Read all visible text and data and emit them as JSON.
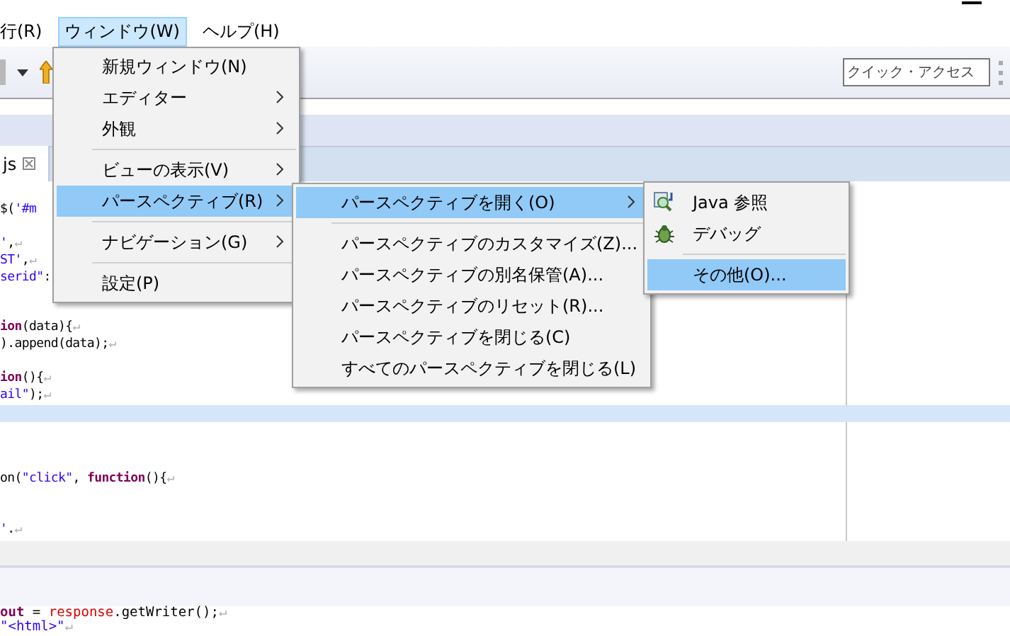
{
  "menu_bar": [
    {
      "label": "行(R)",
      "selected": false
    },
    {
      "label": "ウィンドウ(W)",
      "selected": true
    },
    {
      "label": "ヘルプ(H)",
      "selected": false
    }
  ],
  "toolbar": {
    "quick_access": {
      "placeholder": "クイック・アクセス"
    }
  },
  "editor_tab": {
    "label": "js"
  },
  "editor": {
    "lines": [
      {
        "current": false,
        "segments": [
          {
            "text": "$(",
            "kind": "plain"
          },
          {
            "text": "'#m",
            "kind": "string"
          }
        ]
      },
      {
        "current": false
      },
      {
        "current": false,
        "segments": [
          {
            "text": "'",
            "kind": "string"
          },
          {
            "text": ",",
            "kind": "plain"
          },
          {
            "text": "↵",
            "kind": "mark"
          }
        ]
      },
      {
        "current": false,
        "segments": [
          {
            "text": "ST'",
            "kind": "string"
          },
          {
            "text": ",",
            "kind": "plain"
          },
          {
            "text": "↵",
            "kind": "mark"
          }
        ]
      },
      {
        "current": false,
        "segments": [
          {
            "text": "serid\"",
            "kind": "string"
          },
          {
            "text": ":",
            "kind": "plain"
          }
        ]
      },
      {
        "current": false
      },
      {
        "current": false
      },
      {
        "current": false,
        "segments": [
          {
            "text": "ion",
            "kind": "keyword"
          },
          {
            "text": "(data){",
            "kind": "plain"
          },
          {
            "text": "↵",
            "kind": "mark"
          }
        ]
      },
      {
        "current": false,
        "segments": [
          {
            "text": ").append(data);",
            "kind": "plain"
          },
          {
            "text": "↵",
            "kind": "mark"
          }
        ]
      },
      {
        "current": false
      },
      {
        "current": false,
        "segments": [
          {
            "text": "ion",
            "kind": "keyword"
          },
          {
            "text": "(){",
            "kind": "plain"
          },
          {
            "text": "↵",
            "kind": "mark"
          }
        ]
      },
      {
        "current": false,
        "segments": [
          {
            "text": "ail\"",
            "kind": "string"
          },
          {
            "text": ");",
            "kind": "plain"
          },
          {
            "text": "↵",
            "kind": "mark"
          }
        ]
      },
      {
        "current": true
      },
      {
        "current": false
      },
      {
        "current": false
      },
      {
        "current": false
      },
      {
        "current": false,
        "segments": [
          {
            "text": "on(",
            "kind": "plain"
          },
          {
            "text": "\"click\"",
            "kind": "string"
          },
          {
            "text": ", ",
            "kind": "plain"
          },
          {
            "text": "function",
            "kind": "keyword"
          },
          {
            "text": "(){",
            "kind": "plain"
          },
          {
            "text": "↵",
            "kind": "mark"
          }
        ]
      },
      {
        "current": false
      },
      {
        "current": false
      },
      {
        "current": false,
        "segments": [
          {
            "text": "'",
            "kind": "string"
          },
          {
            "text": ".",
            "kind": "plain"
          },
          {
            "text": "↵",
            "kind": "mark"
          }
        ]
      }
    ]
  },
  "bottom_editor": {
    "lines": [
      {
        "current": false,
        "segments": [
          {
            "text": "out",
            "kind": "keyword"
          },
          {
            "text": " = ",
            "kind": "plain"
          },
          {
            "text": "response",
            "kind": "field"
          },
          {
            "text": ".getWriter();",
            "kind": "plain"
          },
          {
            "text": "↵",
            "kind": "mark"
          }
        ]
      },
      {
        "current": false,
        "segments": [
          {
            "text": "\"<html>\"",
            "kind": "string"
          },
          {
            "text": "↵",
            "kind": "mark"
          }
        ]
      }
    ]
  },
  "window_menu": {
    "items": [
      {
        "label": "新規ウィンドウ(N)",
        "selected": false,
        "submenu": false,
        "separator_before": false
      },
      {
        "label": "エディター",
        "selected": false,
        "submenu": true,
        "separator_before": false
      },
      {
        "label": "外観",
        "selected": false,
        "submenu": true,
        "separator_before": false
      },
      {
        "label": "ビューの表示(V)",
        "selected": false,
        "submenu": true,
        "separator_before": true
      },
      {
        "label": "パースペクティブ(R)",
        "selected": true,
        "submenu": true,
        "separator_before": false
      },
      {
        "label": "ナビゲーション(G)",
        "selected": false,
        "submenu": true,
        "separator_before": true
      },
      {
        "label": "設定(P)",
        "selected": false,
        "submenu": false,
        "separator_before": true
      }
    ]
  },
  "perspective_menu": {
    "items": [
      {
        "label": "パースペクティブを開く(O)",
        "selected": true,
        "submenu": true,
        "separator_before": false
      },
      {
        "label": "パースペクティブのカスタマイズ(Z)...",
        "selected": false,
        "submenu": false,
        "separator_before": true
      },
      {
        "label": "パースペクティブの別名保管(A)...",
        "selected": false,
        "submenu": false,
        "separator_before": false
      },
      {
        "label": "パースペクティブのリセット(R)...",
        "selected": false,
        "submenu": false,
        "separator_before": false
      },
      {
        "label": "パースペクティブを閉じる(C)",
        "selected": false,
        "submenu": false,
        "separator_before": false
      },
      {
        "label": "すべてのパースペクティブを閉じる(L)",
        "selected": false,
        "submenu": false,
        "separator_before": false
      }
    ]
  },
  "open_perspective_menu": {
    "items": [
      {
        "label": "Java 参照",
        "kind": "browse",
        "selected": false,
        "submenu": false,
        "separator_before": false
      },
      {
        "label": "デバッグ",
        "kind": "debug",
        "selected": false,
        "submenu": false,
        "separator_before": false
      },
      {
        "label": "その他(O)...",
        "kind": "plain",
        "selected": true,
        "submenu": false,
        "separator_before": true
      }
    ]
  }
}
